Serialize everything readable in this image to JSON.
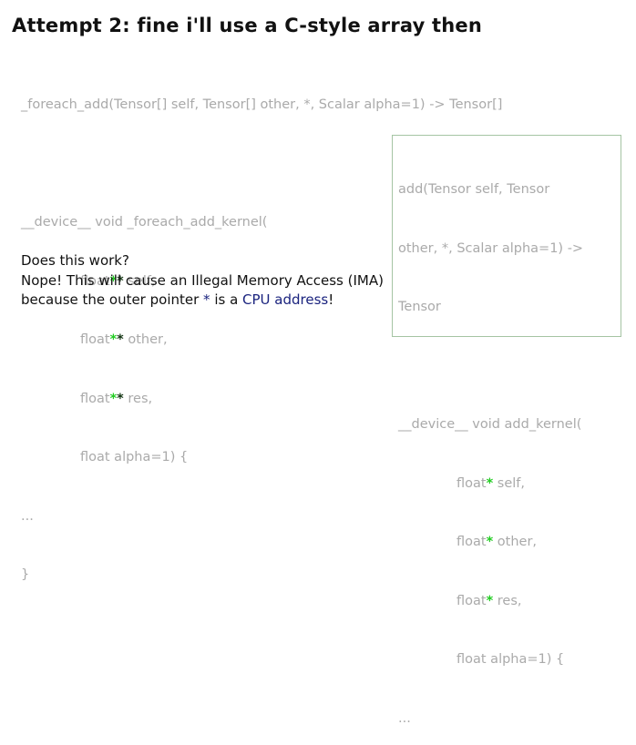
{
  "title": "Attempt 2: fine i'll use a C-style array then",
  "main_code": {
    "signature": "_foreach_add(Tensor[] self, Tensor[] other, *, Scalar alpha=1) -> Tensor[]",
    "kernel_decl": "__device__ void _foreach_add_kernel(",
    "params": [
      {
        "type": "float",
        "name": " self,"
      },
      {
        "type": "float",
        "name": " other,"
      },
      {
        "type": "float",
        "name": " res,"
      }
    ],
    "stars_inner": "*",
    "stars_outer": "*",
    "alpha_param": "float alpha=1) {",
    "ellipsis": "...",
    "close_brace": "}"
  },
  "question": {
    "line1": "Does this work?",
    "line2": "Nope! This will cause an Illegal Memory Access (IMA)",
    "line3_a": "because the outer pointer ",
    "line3_star": "*",
    "line3_b": " is a ",
    "line3_cpu": "CPU address",
    "line3_c": "!"
  },
  "side_code": {
    "sig_line1": "add(Tensor self, Tensor",
    "sig_line2": "other, *, Scalar alpha=1) ->",
    "sig_line3": "Tensor",
    "kernel_decl": "__device__ void add_kernel(",
    "params": [
      {
        "type": "float",
        "name": " self,"
      },
      {
        "type": "float",
        "name": " other,"
      },
      {
        "type": "float",
        "name": " res,"
      }
    ],
    "star": "*",
    "alpha_param": "float alpha=1) {",
    "ellipsis": "..."
  },
  "colors": {
    "green_star": "#22cc22",
    "code_gray": "#aaaaaa",
    "accent_blue": "#1a237e",
    "box_border": "#a5c4a3"
  }
}
